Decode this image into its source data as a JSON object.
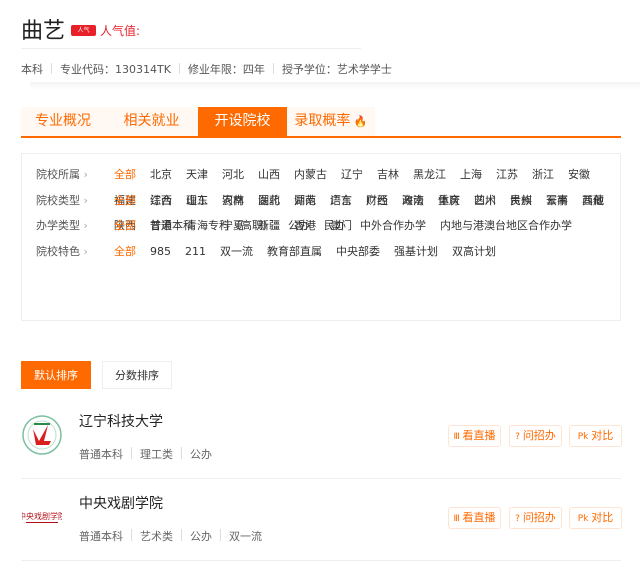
{
  "header": {
    "title": "曲艺",
    "badge": "人气",
    "popularity_label": "人气值:"
  },
  "info": [
    "本科",
    "专业代码：130314TK",
    "修业年限：四年",
    "授予学位：艺术学学士"
  ],
  "tabs": [
    {
      "label": "专业概况"
    },
    {
      "label": "相关就业"
    },
    {
      "label": "开设院校",
      "active": true
    },
    {
      "label": "录取概率"
    }
  ],
  "filters": [
    {
      "label": "院校所属",
      "items": [
        "全部",
        "北京",
        "天津",
        "河北",
        "山西",
        "内蒙古",
        "辽宁",
        "吉林",
        "黑龙江",
        "上海",
        "江苏",
        "浙江",
        "安徽",
        "福建",
        "江西",
        "山东",
        "河南",
        "湖北",
        "湖南",
        "广东",
        "广西",
        "海南",
        "重庆",
        "四川",
        "贵州",
        "云南",
        "西藏",
        "陕西",
        "甘肃",
        "青海",
        "宁夏",
        "新疆",
        "香港",
        "澳门"
      ]
    },
    {
      "label": "院校类型",
      "items": [
        "全部",
        "综合",
        "理工",
        "农林",
        "医药",
        "师范",
        "语言",
        "财经",
        "政法",
        "体育",
        "艺术",
        "民族",
        "军事",
        "其他"
      ]
    },
    {
      "label": "办学类型",
      "items": [
        "全部",
        "普通本科",
        "专科（高职）",
        "公办",
        "民办",
        "中外合作办学",
        "内地与港澳台地区合作办学"
      ]
    },
    {
      "label": "院校特色",
      "items": [
        "全部",
        "985",
        "211",
        "双一流",
        "教育部直属",
        "中央部委",
        "强基计划",
        "双高计划"
      ]
    }
  ],
  "sort": {
    "default": "默认排序",
    "score": "分数排序"
  },
  "schools": [
    {
      "name": "辽宁科技大学",
      "tags": [
        "普通本科",
        "理工类",
        "公办"
      ]
    },
    {
      "name": "中央戏剧学院",
      "tags": [
        "普通本科",
        "艺术类",
        "公办",
        "双一流"
      ]
    }
  ],
  "actions": {
    "live": "看直播",
    "ask": "问招办",
    "compare": "对比"
  },
  "colors": {
    "accent": "#ff6a00",
    "red": "#e8202a"
  }
}
